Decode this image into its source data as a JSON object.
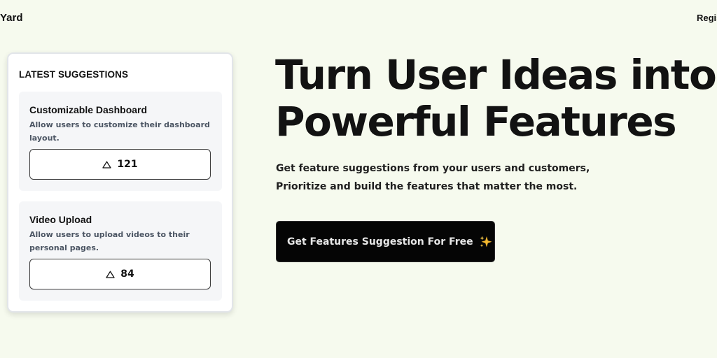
{
  "header": {
    "brand": "Yard",
    "register_label": "Regis"
  },
  "suggestions": {
    "title": "LATEST SUGGESTIONS",
    "items": [
      {
        "title": "Customizable Dashboard",
        "description": "Allow users to customize their dashboard layout.",
        "votes": "121"
      },
      {
        "title": "Video Upload",
        "description": "Allow users to upload videos to their personal pages.",
        "votes": "84"
      }
    ]
  },
  "hero": {
    "title_line1": "Turn User Ideas into",
    "title_line2": "Powerful Features",
    "subtitle_line1": "Get feature suggestions from your users and customers,",
    "subtitle_line2": "Prioritize and build the features that matter the most.",
    "cta_label": "Get Features Suggestion For Free",
    "cta_icon": "sparkles-icon"
  },
  "colors": {
    "background": "#f6faee",
    "cta_background": "#050505",
    "text": "#121212",
    "sparkle": "#f5b82e"
  }
}
